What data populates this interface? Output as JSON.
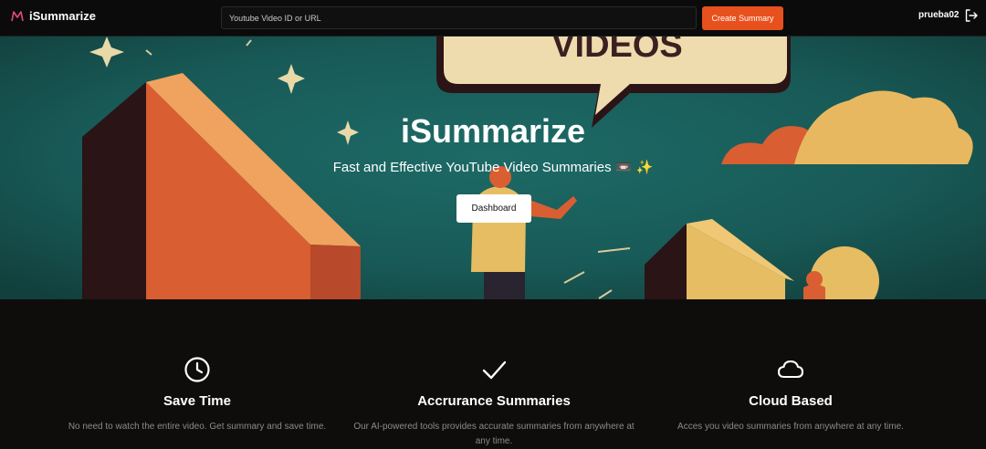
{
  "nav": {
    "brand": "iSummarize",
    "search_placeholder": "Youtube Video ID or URL",
    "create_label": "Create Summary",
    "username": "prueba02"
  },
  "hero": {
    "title": "iSummarize",
    "subtitle": "Fast and Effective YouTube Video Summaries 📼 ✨",
    "dashboard_label": "Dashboard",
    "art_bubble_text": "VIDEOS"
  },
  "features": [
    {
      "icon": "clock-icon",
      "title": "Save Time",
      "description": "No need to watch the entire video. Get summary and save time."
    },
    {
      "icon": "check-icon",
      "title": "Accrurance Summaries",
      "description": "Our AI-powered tools provides accurate summaries from anywhere at any time."
    },
    {
      "icon": "cloud-icon",
      "title": "Cloud Based",
      "description": "Acces you video summaries from anywhere at any time."
    }
  ],
  "colors": {
    "accent": "#e8501d",
    "background": "#0e0d0c",
    "hero_bg": "#174f4c"
  }
}
